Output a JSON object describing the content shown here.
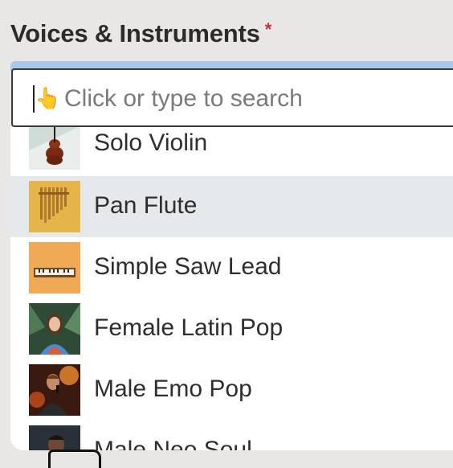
{
  "field": {
    "label": "Voices & Instruments",
    "required_mark": "*"
  },
  "search": {
    "placeholder": "Click or type to search",
    "cursor_icon": "pointing-hand-icon"
  },
  "options": [
    {
      "label": "Solo Violin",
      "thumbnail": "violin-thumbnail",
      "highlighted": false
    },
    {
      "label": "Pan Flute",
      "thumbnail": "pan-flute-thumbnail",
      "highlighted": true
    },
    {
      "label": "Simple Saw Lead",
      "thumbnail": "synth-keyboard-thumbnail",
      "highlighted": false
    },
    {
      "label": "Female Latin Pop",
      "thumbnail": "female-singer-thumbnail",
      "highlighted": false
    },
    {
      "label": "Male Emo Pop",
      "thumbnail": "male-singer-thumbnail",
      "highlighted": false
    },
    {
      "label": "Male Neo Soul",
      "thumbnail": "male-soul-singer-thumbnail",
      "highlighted": false
    }
  ],
  "colors": {
    "required": "#c0392b",
    "focus_ring": "#a9c8ec",
    "highlight_row": "#e6e9ec"
  }
}
